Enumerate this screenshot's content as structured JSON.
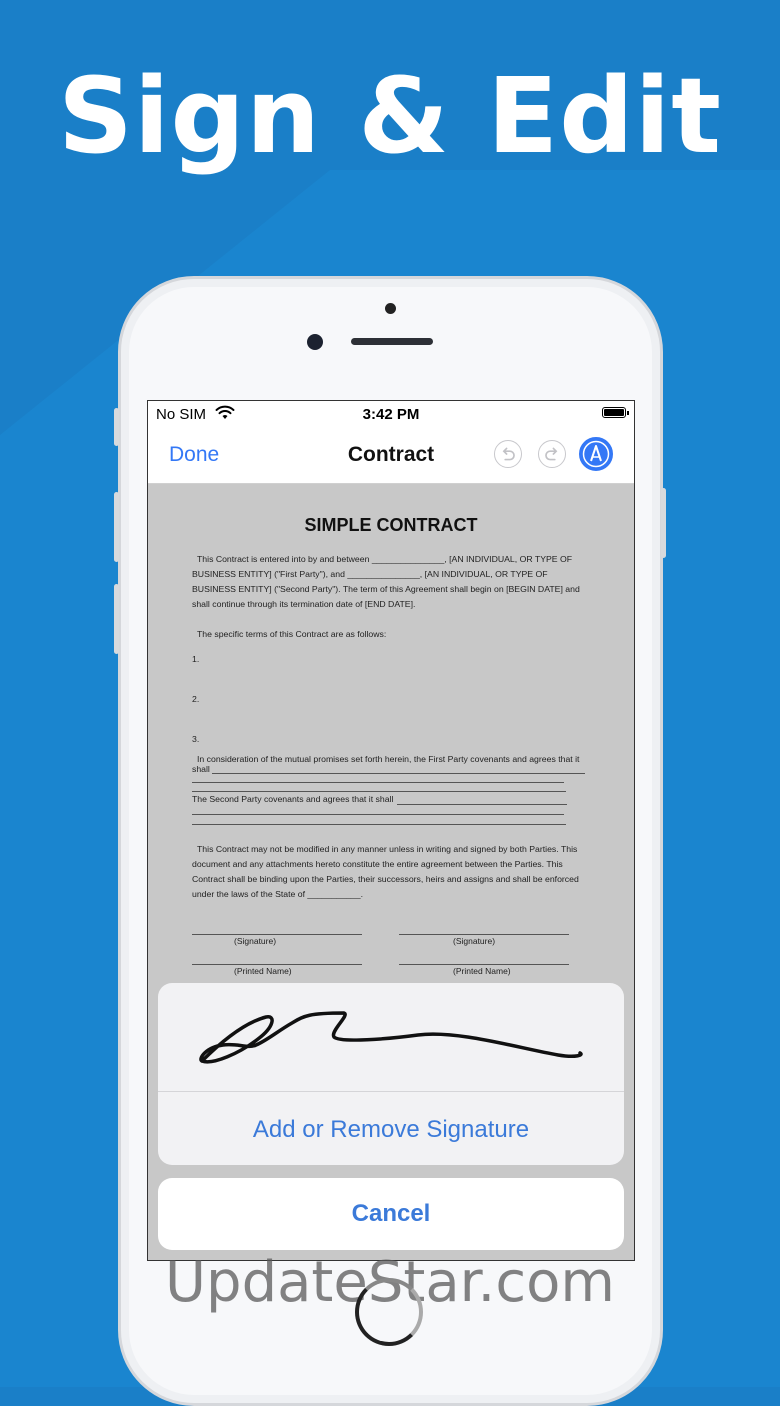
{
  "headline": "Sign & Edit",
  "colors": {
    "background": "#1A7FC8",
    "accent": "#3478f6"
  },
  "status_bar": {
    "carrier": "No SIM",
    "time": "3:42 PM"
  },
  "navbar": {
    "done_label": "Done",
    "title": "Contract"
  },
  "icons": {
    "undo": "undo-icon",
    "redo": "redo-icon",
    "markup": "markup-pen-icon",
    "wifi": "wifi-icon",
    "battery": "battery-icon"
  },
  "document": {
    "title": "SIMPLE CONTRACT",
    "para1": [
      "This Contract is entered into by and between _______________, [AN INDIVIDUAL, OR TYPE OF",
      "BUSINESS ENTITY] (\"First Party\"), and _______________, [AN INDIVIDUAL, OR TYPE OF",
      "BUSINESS ENTITY] (\"Second Party\").   The term of this Agreement shall begin on [BEGIN DATE] and",
      "shall continue through its termination date of [END DATE]."
    ],
    "terms_intro": "The specific terms of this Contract are as follows:",
    "items": [
      "1.",
      "2.",
      "3."
    ],
    "consideration": [
      "In consideration of the mutual promises set forth herein, the First Party covenants and agrees that it",
      "shall"
    ],
    "second_party": "The Second Party covenants and agrees that it shall",
    "para_final": [
      "This Contract may not be modified in any manner unless in writing and signed by both Parties. This",
      "document and any attachments hereto constitute the entire agreement between the Parties.  This",
      "Contract shall be binding upon the Parties, their successors, heirs and assigns and shall be enforced",
      "under the laws of the State of ___________."
    ],
    "signature_label": "(Signature)",
    "printed_name_label": "(Printed Name)"
  },
  "sheet": {
    "action_label": "Add or Remove Signature",
    "cancel_label": "Cancel"
  },
  "watermark": "UpdateStar.com"
}
